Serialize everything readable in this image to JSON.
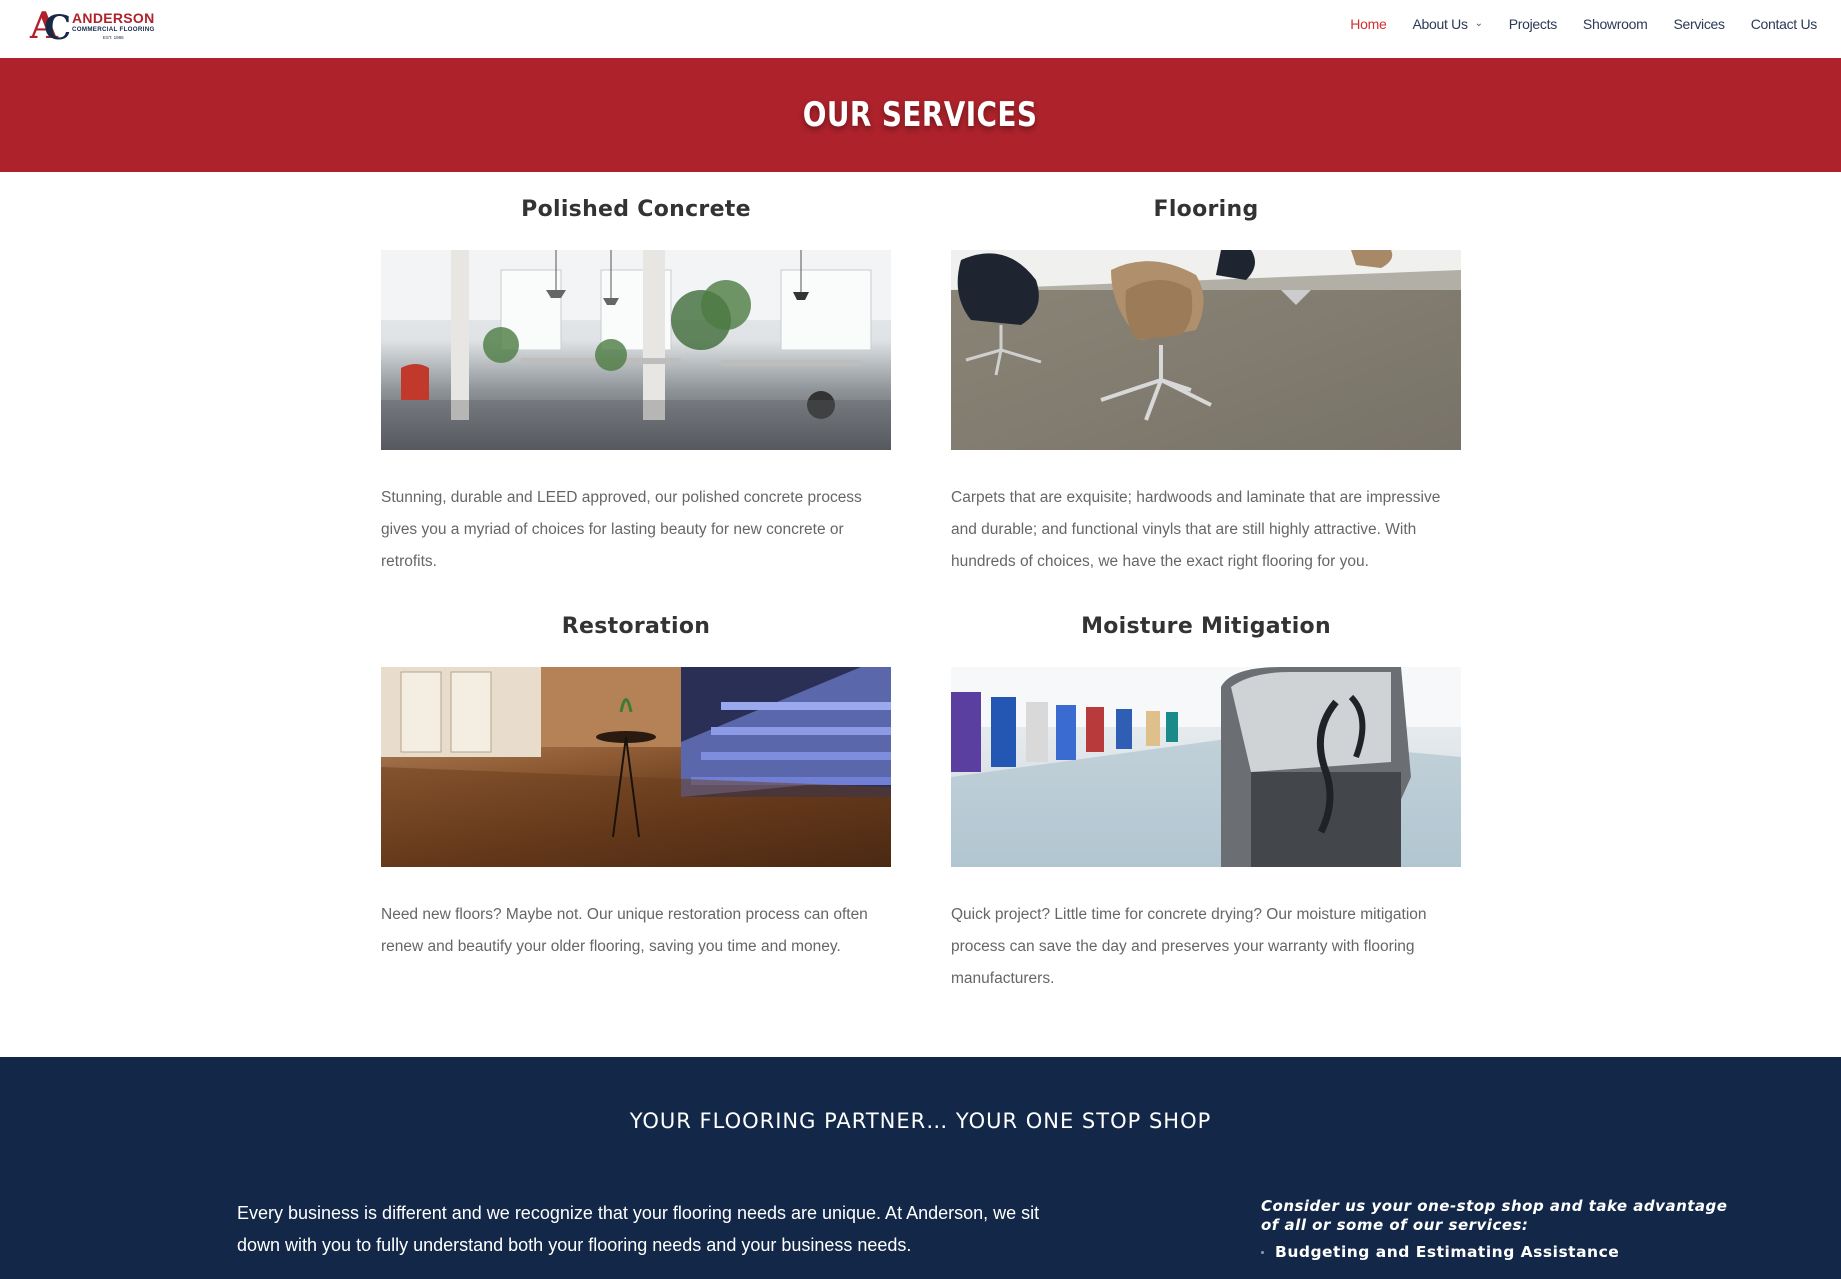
{
  "header": {
    "logo": {
      "name": "ANDERSON",
      "sub": "COMMERCIAL FLOORING",
      "est": "EST. 1986"
    },
    "nav": [
      {
        "label": "Home",
        "active": true
      },
      {
        "label": "About Us",
        "has_dropdown": true
      },
      {
        "label": "Projects"
      },
      {
        "label": "Showroom"
      },
      {
        "label": "Services"
      },
      {
        "label": "Contact Us"
      }
    ]
  },
  "banner": {
    "title": "OUR SERVICES"
  },
  "services": [
    {
      "title": "Polished Concrete",
      "image": "office-interior-polished-concrete",
      "text": "Stunning, durable and LEED approved, our polished concrete process gives you a myriad of choices for lasting beauty for new concrete or retrofits."
    },
    {
      "title": "Flooring",
      "image": "swivel-chairs-on-vinyl-flooring",
      "text": "Carpets that are exquisite; hardwoods and laminate that are impressive and durable; and functional vinyls that are still highly attractive.  With hundreds of choices, we have the exact right flooring for you."
    },
    {
      "title": "Restoration",
      "image": "hardwood-floor-and-glass-staircase",
      "text": "Need new floors?  Maybe not.  Our unique restoration process can often renew and beautify your older flooring, saving you time and money."
    },
    {
      "title": "Moisture Mitigation",
      "image": "floor-scrubber-in-warehouse",
      "text": "Quick project?  Little time for concrete drying?  Our moisture mitigation process can save the day and preserves your warranty with flooring manufacturers."
    }
  ],
  "partner": {
    "heading": "YOUR FLOORING PARTNER… YOUR ONE STOP SHOP",
    "lead": "Every business is different and we recognize that your flooring needs are unique.  At Anderson, we sit down with you to fully understand both your flooring needs and your business needs.",
    "consider": "Consider us your one-stop shop and take advantage of all or some of our services:",
    "list": [
      "Budgeting and Estimating Assistance"
    ]
  },
  "colors": {
    "brand_red": "#ad222b",
    "nav_active": "#d32f2f",
    "navy": "#132848"
  }
}
